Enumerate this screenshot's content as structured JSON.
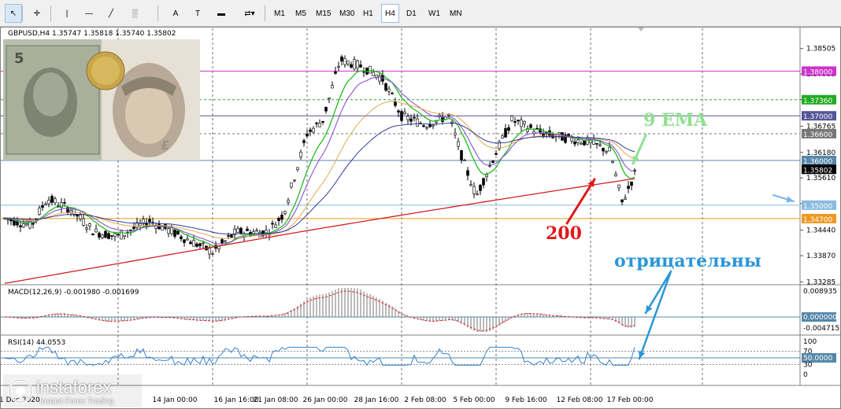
{
  "toolbar": {
    "tools": [
      {
        "name": "cursor-icon",
        "glyph": "↖",
        "active": true
      },
      {
        "name": "crosshair-icon",
        "glyph": "✛"
      },
      {
        "name": "vertical-line-icon",
        "glyph": "|"
      },
      {
        "name": "horizontal-line-icon",
        "glyph": "—"
      },
      {
        "name": "trendline-icon",
        "glyph": "╱"
      },
      {
        "name": "fibonacci-icon",
        "glyph": "░"
      },
      {
        "name": "text-icon",
        "glyph": "A"
      },
      {
        "name": "text-label-icon",
        "glyph": "T"
      },
      {
        "name": "rectangle-icon",
        "glyph": "▬"
      },
      {
        "name": "arrows-icon",
        "glyph": "⇄▾"
      }
    ],
    "timeframes": [
      "M1",
      "M5",
      "M15",
      "M30",
      "H1",
      "H4",
      "D1",
      "W1",
      "MN"
    ],
    "active_timeframe": "H4"
  },
  "chart": {
    "symbol_label": "GBPUSD,H4  1.35747 1.35818 1.35740 1.35802",
    "price_labels": [
      "1.38505",
      "1.37935",
      "1.37360",
      "1.36765",
      "1.36180",
      "1.35610",
      "1.35035",
      "1.34440",
      "1.33870",
      "1.33285"
    ],
    "level_labels": [
      {
        "text": "1.38000",
        "color": "#cc33cc"
      },
      {
        "text": "1.37360",
        "color": "#22aa22"
      },
      {
        "text": "1.37000",
        "color": "#555599"
      },
      {
        "text": "1.36600",
        "color": "#777777"
      },
      {
        "text": "1.36000",
        "color": "#5588aa"
      },
      {
        "text": "1.35802",
        "color": "#000000"
      },
      {
        "text": "1.35000",
        "color": "#88bbdd"
      },
      {
        "text": "1.34700",
        "color": "#ee9922"
      }
    ],
    "time_labels": [
      "31 Dec 2020",
      "14 Jan 00:00",
      "16 Jan 16:00",
      "21 Jan 08:00",
      "26 Jan 00:00",
      "28 Jan 16:00",
      "2 Feb 08:00",
      "5 Feb 00:00",
      "9 Feb 16:00",
      "12 Feb 08:00",
      "17 Feb 00:00"
    ]
  },
  "macd": {
    "label": "MACD(12,26,9) -0.001980 -0.001699",
    "scale_labels": [
      "0.008935",
      "0.000000",
      "-0.004715"
    ]
  },
  "rsi": {
    "label": "RSI(14) 44.0553",
    "scale_labels": [
      "100",
      "70",
      "50.0000",
      "30",
      "0"
    ]
  },
  "annotations": {
    "ema": "9 EMA",
    "ma200": "200",
    "negative": "отрицательны"
  },
  "logo": {
    "name": "instaforex",
    "tagline": "Instant Forex Trading"
  },
  "colors": {
    "ema9": "#22bb22",
    "ma200": "#cc2222",
    "annotation_ema": "#90e090",
    "annotation_200": "#e01818",
    "annotation_negative": "#2a96d8"
  }
}
